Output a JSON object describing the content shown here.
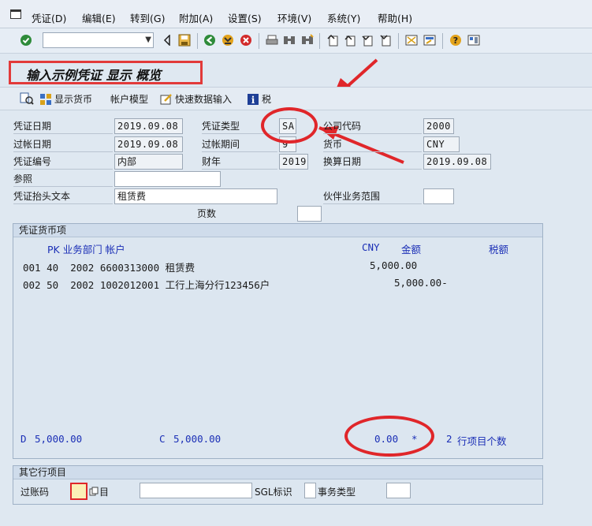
{
  "menu": {
    "items": [
      "凭证(D)",
      "编辑(E)",
      "转到(G)",
      "附加(A)",
      "设置(S)",
      "环境(V)",
      "系统(Y)",
      "帮助(H)"
    ]
  },
  "toolbar": {
    "command_field_value": "",
    "icons": [
      "enter-icon",
      "save-icon",
      "back-icon",
      "exit-icon",
      "cancel-icon",
      "print-icon",
      "find-icon",
      "find-next-icon",
      "first-page-icon",
      "prev-page-icon",
      "next-page-icon",
      "last-page-icon",
      "create-session-icon",
      "shortcut-icon",
      "help-icon",
      "layout-icon"
    ]
  },
  "title": "输入示例凭证 显示 概览",
  "app_toolbar": {
    "display_currency": "显示货币",
    "account_model": "帐户模型",
    "fast_entry": "快速数据输入",
    "tax": "税"
  },
  "header": {
    "doc_date_label": "凭证日期",
    "doc_date": "2019.09.08",
    "doc_type_label": "凭证类型",
    "doc_type": "SA",
    "company_code_label": "公司代码",
    "company_code": "2000",
    "posting_date_label": "过帐日期",
    "posting_date": "2019.09.08",
    "period_label": "过帐期间",
    "period": "9",
    "currency_label": "货币",
    "currency": "CNY",
    "doc_number_label": "凭证编号",
    "doc_number": "内部",
    "fiscal_year_label": "财年",
    "fiscal_year": "2019",
    "translation_date_label": "换算日期",
    "translation_date": "2019.09.08",
    "reference_label": "参照",
    "reference": "",
    "header_text_label": "凭证抬头文本",
    "header_text": "租赁费",
    "partner_area_label": "伙伴业务范围",
    "partner_area": "",
    "pages_label": "页数",
    "pages": ""
  },
  "items_group": {
    "title": "凭证货币项",
    "col_left": "PK 业务部门 帐户",
    "col_currency": "CNY",
    "col_amount": "金额",
    "col_tax": "税额",
    "rows": [
      {
        "line": "001 40  2002 6600313000 租赁费",
        "amount": "5,000.00"
      },
      {
        "line": "002 50  2002 1002012001 工行上海分行123456户",
        "amount": "5,000.00-"
      }
    ],
    "debit_label": "D",
    "debit_total": "5,000.00",
    "credit_label": "C",
    "credit_total": "5,000.00",
    "balance": "0.00",
    "balance_flag": "*",
    "item_count": "2",
    "item_count_label": "行项目个数"
  },
  "other_group": {
    "title": "其它行项目",
    "posting_key_label": "过账码",
    "posting_key": "",
    "account_label": "目",
    "account": "",
    "sgl_label": "SGL标识",
    "sgl": "",
    "trans_type_label": "事务类型",
    "trans_type": ""
  },
  "colors": {
    "annotation": "#e0262a",
    "text_blue": "#1b2fb6",
    "background": "#dfe8f1"
  }
}
